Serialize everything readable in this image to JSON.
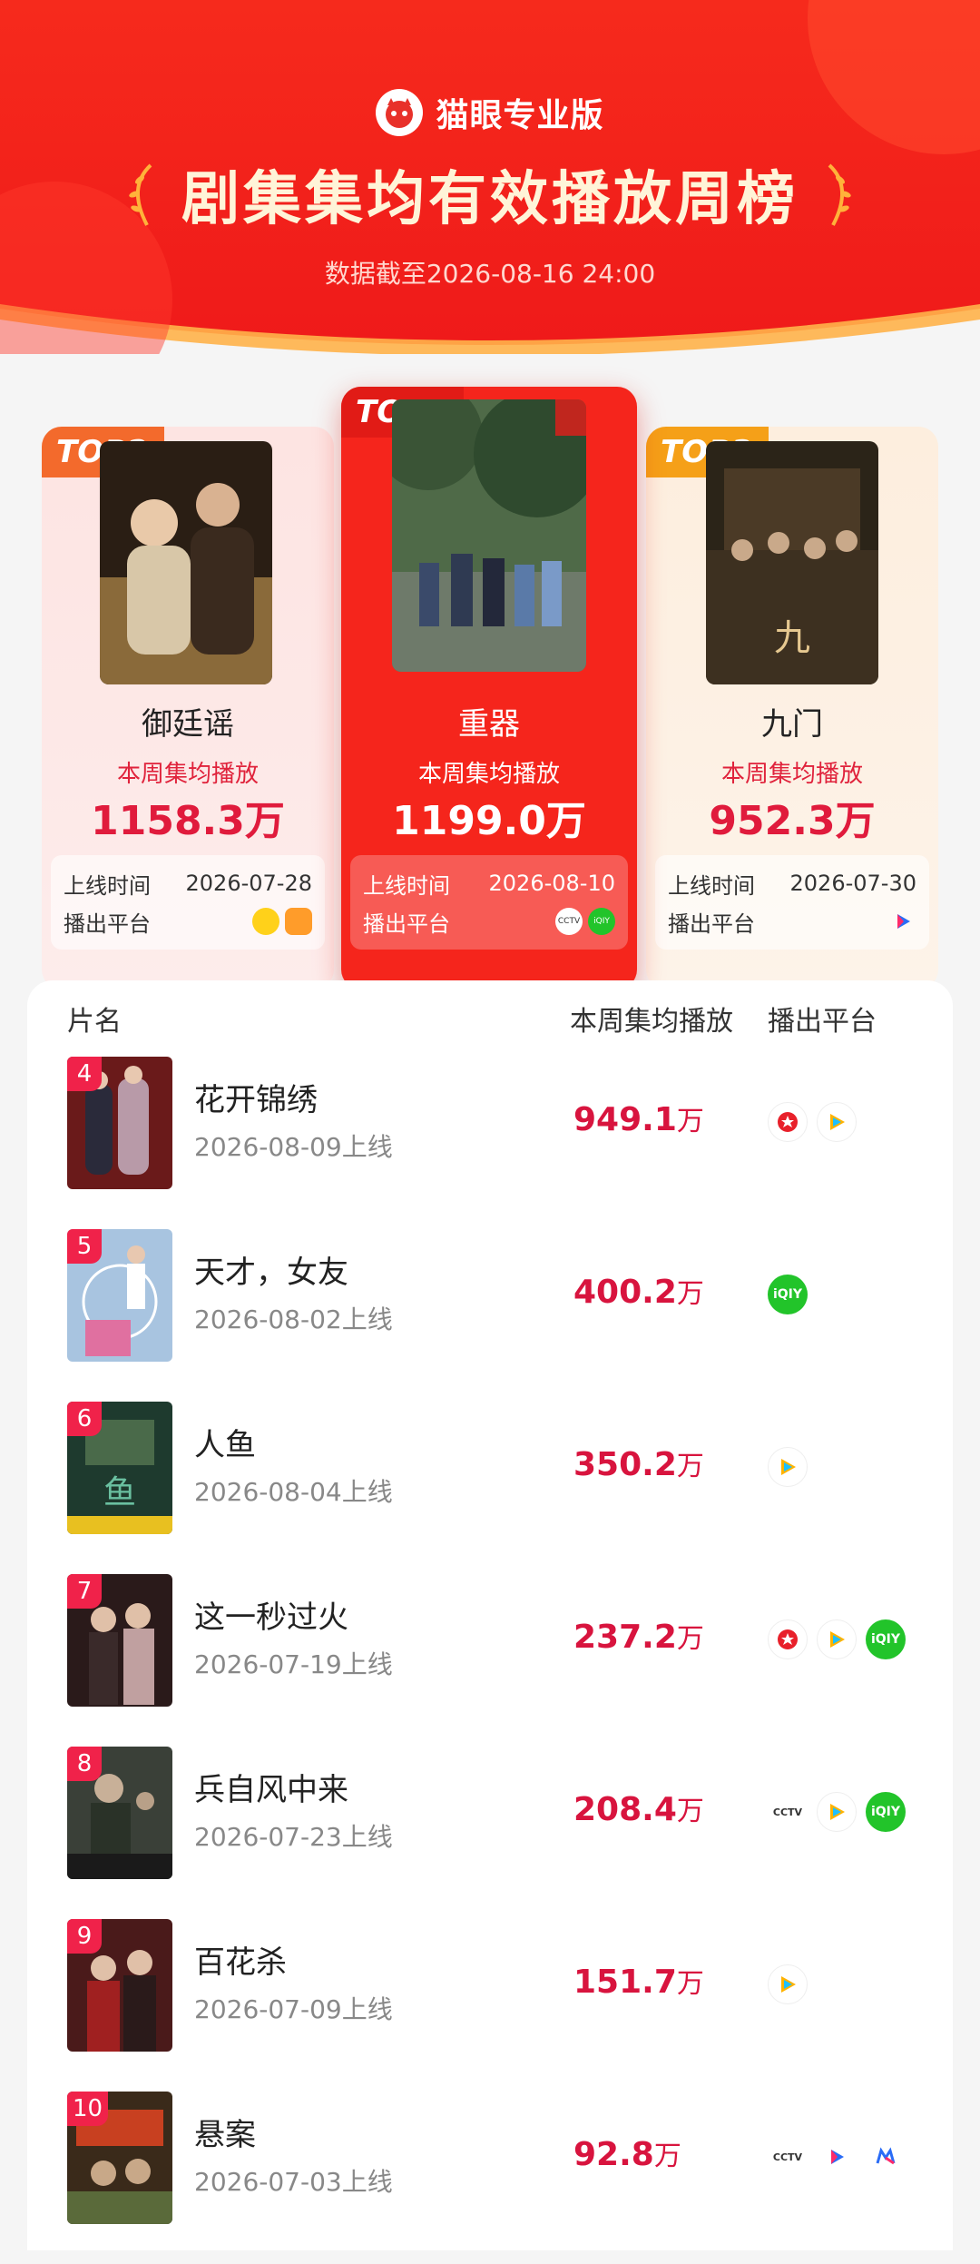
{
  "header": {
    "brand": "猫眼专业版",
    "title": "剧集集均有效播放周榜",
    "subtitle": "数据截至2026-08-16 24:00"
  },
  "labels": {
    "weekly_play": "本周集均播放",
    "online_time": "上线时间",
    "platform": "播出平台"
  },
  "podium": [
    {
      "badge": "TOP2",
      "name": "御廷谣",
      "play": "1158.3万",
      "date": "2026-07-28",
      "platforms": [
        "mango-icon",
        "youku-orange-icon"
      ]
    },
    {
      "badge": "TOP1",
      "name": "重器",
      "play": "1199.0万",
      "date": "2026-08-10",
      "platforms": [
        "cctv-icon",
        "iqiyi-icon"
      ]
    },
    {
      "badge": "TOP3",
      "name": "九门",
      "play": "952.3万",
      "date": "2026-07-30",
      "platforms": [
        "youku-icon"
      ]
    }
  ],
  "table": {
    "col_name": "片名",
    "col_play": "本周集均播放",
    "col_platform": "播出平台",
    "rows": [
      {
        "rank": "4",
        "title": "花开锦绣",
        "date": "2026-08-09上线",
        "play": "949.1",
        "unit": "万",
        "platforms": [
          "tencent-icon",
          "tencent-video-icon"
        ]
      },
      {
        "rank": "5",
        "title": "天才，女友",
        "date": "2026-08-02上线",
        "play": "400.2",
        "unit": "万",
        "platforms": [
          "iqiyi-icon"
        ]
      },
      {
        "rank": "6",
        "title": "人鱼",
        "date": "2026-08-04上线",
        "play": "350.2",
        "unit": "万",
        "platforms": [
          "tencent-video-icon"
        ]
      },
      {
        "rank": "7",
        "title": "这一秒过火",
        "date": "2026-07-19上线",
        "play": "237.2",
        "unit": "万",
        "platforms": [
          "tencent-icon",
          "tencent-video-icon",
          "iqiyi-icon"
        ]
      },
      {
        "rank": "8",
        "title": "兵自风中来",
        "date": "2026-07-23上线",
        "play": "208.4",
        "unit": "万",
        "platforms": [
          "cctv-icon",
          "tencent-video-icon",
          "iqiyi-icon"
        ]
      },
      {
        "rank": "9",
        "title": "百花杀",
        "date": "2026-07-09上线",
        "play": "151.7",
        "unit": "万",
        "platforms": [
          "tencent-video-icon"
        ]
      },
      {
        "rank": "10",
        "title": "悬案",
        "date": "2026-07-03上线",
        "play": "92.8",
        "unit": "万",
        "platforms": [
          "cctv-icon",
          "youku-icon",
          "mgtv-icon"
        ]
      }
    ]
  }
}
